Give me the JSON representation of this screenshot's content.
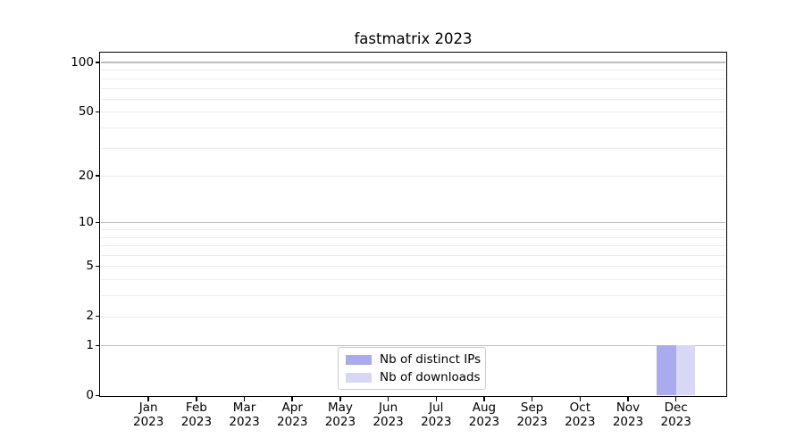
{
  "chart_data": {
    "type": "bar",
    "title": "fastmatrix 2023",
    "categories": [
      "Jan 2023",
      "Feb 2023",
      "Mar 2023",
      "Apr 2023",
      "May 2023",
      "Jun 2023",
      "Jul 2023",
      "Aug 2023",
      "Sep 2023",
      "Oct 2023",
      "Nov 2023",
      "Dec 2023"
    ],
    "series": [
      {
        "name": "Nb of distinct IPs",
        "color": "#aaaaee",
        "values": [
          0,
          0,
          0,
          0,
          0,
          0,
          0,
          0,
          0,
          0,
          0,
          1
        ]
      },
      {
        "name": "Nb of downloads",
        "color": "#d8d8f6",
        "values": [
          0,
          0,
          0,
          0,
          0,
          0,
          0,
          0,
          0,
          0,
          0,
          1
        ]
      }
    ],
    "xlabel": "",
    "ylabel": "",
    "yscale": "log1p",
    "ylim": [
      0,
      100
    ],
    "yticks": [
      0,
      1,
      2,
      5,
      10,
      20,
      50,
      100
    ],
    "grid": "horizontal",
    "legend_position": "lower center"
  }
}
